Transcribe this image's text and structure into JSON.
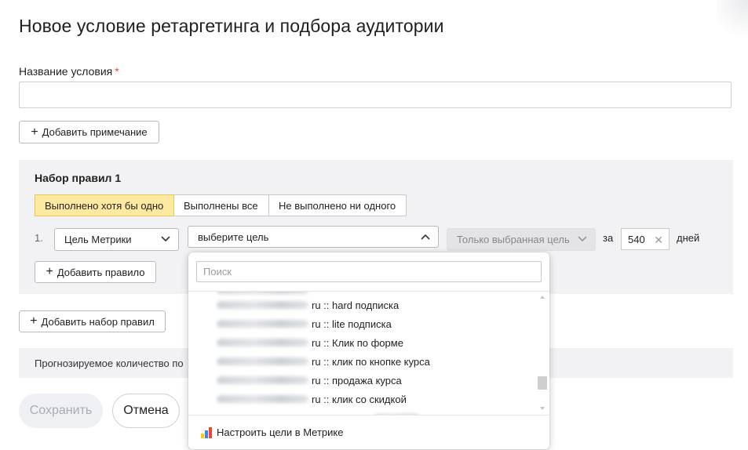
{
  "page": {
    "title": "Новое условие ретаргетинга и подбора аудитории"
  },
  "name_field": {
    "label": "Название условия",
    "required_mark": "*",
    "value": ""
  },
  "add_note_button": "Добавить примечание",
  "ruleset": {
    "title": "Набор правил 1",
    "modes": [
      "Выполнено хотя бы одно",
      "Выполнены все",
      "Не выполнено ни одного"
    ],
    "active_mode": "Выполнено хотя бы одно",
    "rule": {
      "number": "1.",
      "type_select": "Цель Метрики",
      "goal_select": "выберите цель",
      "scope_select": "Только выбранная цель",
      "za_label": "за",
      "days_value": "540",
      "days_label": "дней"
    },
    "add_rule_button": "Добавить правило"
  },
  "add_ruleset_button": "Добавить набор правил",
  "forecast_text": "Прогнозируемое количество по",
  "actions": {
    "save": "Сохранить",
    "cancel": "Отмена"
  },
  "goal_dropdown": {
    "search_placeholder": "Поиск",
    "items": [
      "ru :: hard подписка",
      "ru :: lite подписка",
      "ru :: Клик по форме",
      "ru :: клик по кнопке курса",
      "ru :: продажа курса",
      "ru :: клик со скидкой"
    ],
    "footer_link": "Настроить цели в Метрике"
  },
  "colors": {
    "active_segment_bg": "#fde9a0",
    "panel_bg": "#f2f2f4",
    "required_star": "#e64a3b",
    "metrika_icon": [
      "#ffcc00",
      "#3b82f6",
      "#f04438"
    ]
  }
}
